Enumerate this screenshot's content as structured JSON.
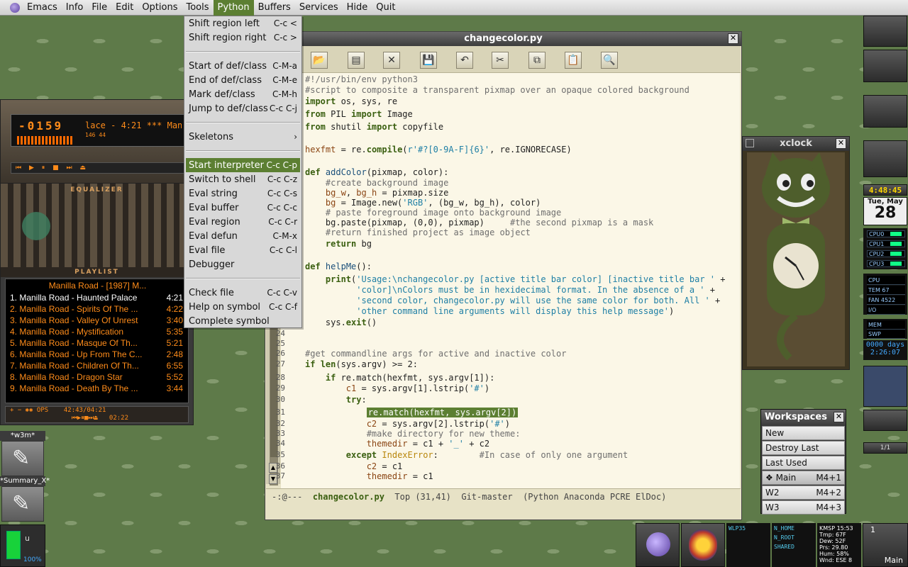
{
  "menubar": {
    "items": [
      "Emacs",
      "Info",
      "File",
      "Edit",
      "Options",
      "Tools",
      "Python",
      "Buffers",
      "Services",
      "Hide",
      "Quit"
    ]
  },
  "python_menu": {
    "rows": [
      {
        "label": "Shift region left",
        "key": "C-c <"
      },
      {
        "label": "Shift region right",
        "key": "C-c >"
      },
      {
        "sep": true
      },
      {
        "label": "Start of def/class",
        "key": "C-M-a"
      },
      {
        "label": "End of def/class",
        "key": "C-M-e"
      },
      {
        "label": "Mark def/class",
        "key": "C-M-h"
      },
      {
        "label": "Jump to def/class",
        "key": "C-c C-j"
      },
      {
        "sep": true
      },
      {
        "label": "Skeletons",
        "key": "›"
      },
      {
        "sep": true
      },
      {
        "label": "Start interpreter",
        "key": "C-c C-p",
        "highlight": true
      },
      {
        "label": "Switch to shell",
        "key": "C-c C-z"
      },
      {
        "label": "Eval string",
        "key": "C-c C-s"
      },
      {
        "label": "Eval buffer",
        "key": "C-c C-c"
      },
      {
        "label": "Eval region",
        "key": "C-c C-r"
      },
      {
        "label": "Eval defun",
        "key": "C-M-x"
      },
      {
        "label": "Eval file",
        "key": "C-c C-l"
      },
      {
        "label": "Debugger",
        "key": ""
      },
      {
        "sep": true
      },
      {
        "label": "Check file",
        "key": "C-c C-v"
      },
      {
        "label": "Help on symbol",
        "key": "C-c C-f"
      },
      {
        "label": "Complete symbol",
        "key": ""
      }
    ]
  },
  "emacs": {
    "title": "changecolor.py",
    "modeline": {
      "flags": "-:@---",
      "buffer": "changecolor.py",
      "position": "Top (31,41)",
      "vc": "Git-master",
      "modes": "(Python Anaconda PCRE ElDoc)"
    },
    "code": [
      {
        "n": "",
        "html": "<span class='cm'>#!/usr/bin/env python3</span>"
      },
      {
        "n": "",
        "html": "<span class='cm'>#script to composite a transparent pixmap over an opaque colored background</span>"
      },
      {
        "n": "",
        "html": "<span class='kw'>import</span> os, sys, re"
      },
      {
        "n": "",
        "html": "<span class='kw'>from</span> PIL <span class='kw'>import</span> Image"
      },
      {
        "n": "",
        "html": "<span class='kw'>from</span> shutil <span class='kw'>import</span> copyfile"
      },
      {
        "n": "",
        "html": ""
      },
      {
        "n": "",
        "html": "<span class='var'>hexfmt</span> = re.<span class='kw'>compile</span>(<span class='st'>r'#?[0-9A-F]{6}'</span>, re.IGNORECASE)"
      },
      {
        "n": "",
        "html": ""
      },
      {
        "n": "",
        "html": "<span class='kw'>def</span> <span class='fn'>addColor</span>(pixmap, color):"
      },
      {
        "n": "",
        "html": "    <span class='cm'>#create background image</span>"
      },
      {
        "n": "",
        "html": "    <span class='var'>bg_w</span>, <span class='var'>bg_h</span> = pixmap.size"
      },
      {
        "n": "",
        "html": "    <span class='var'>bg</span> = Image.new(<span class='st'>'RGB'</span>, (bg_w, bg_h), color)"
      },
      {
        "n": "",
        "html": "    <span class='cm'># paste foreground image onto background image</span>"
      },
      {
        "n": "",
        "html": "    bg.paste(pixmap, (0,0), pixmap)     <span class='cm'>#the second pixmap is a mask</span>"
      },
      {
        "n": "",
        "html": "    <span class='cm'>#return finished project as image object</span>"
      },
      {
        "n": "",
        "html": "    <span class='kw'>return</span> bg"
      },
      {
        "n": "",
        "html": ""
      },
      {
        "n": "",
        "html": "<span class='kw'>def</span> <span class='fn'>helpMe</span>():"
      },
      {
        "n": "",
        "html": "    <span class='kw'>print</span>(<span class='st'>'Usage:\\nchangecolor.py [active title bar color] [inactive title bar '</span> +"
      },
      {
        "n": "",
        "html": "          <span class='st'>'color]\\nColors must be in hexidecimal format. In the absence of a '</span> +"
      },
      {
        "n": "",
        "html": "          <span class='st'>'second color, changecolor.py will use the same color for both. All '</span> +"
      },
      {
        "n": "",
        "html": "          <span class='st'>'other command line arguments will display this help message'</span>)"
      },
      {
        "n": "",
        "html": "    sys.<span class='kw'>exit</span>()"
      },
      {
        "n": "24",
        "html": ""
      },
      {
        "n": "25",
        "html": ""
      },
      {
        "n": "26",
        "html": "<span class='cm'>#get commandline args for active and inactive color</span>"
      },
      {
        "n": "27",
        "html": "<span class='kw'>if</span> <span class='kw'>len</span>(sys.argv) &gt;= 2:"
      },
      {
        "n": "28",
        "html": "    <span class='kw'>if</span> re.match(hexfmt, sys.argv[1]):"
      },
      {
        "n": "29",
        "html": "        <span class='var'>c1</span> = sys.argv[1].lstrip(<span class='st'>'#'</span>)"
      },
      {
        "n": "30",
        "html": "        <span class='kw'>try</span>:"
      },
      {
        "n": "31",
        "html": "            <span class='hlline'>re.match(hexfmt, sys.argv[2])</span>"
      },
      {
        "n": "32",
        "html": "            <span class='var'>c2</span> = sys.argv[2].lstrip(<span class='st'>'#'</span>)"
      },
      {
        "n": "33",
        "html": "            <span class='cm'>#make directory for new theme:</span>"
      },
      {
        "n": "34",
        "html": "            <span class='var'>themedir</span> = c1 + <span class='st'>'_'</span> + c2"
      },
      {
        "n": "35",
        "html": "        <span class='kw'>except</span> <span class='cls'>IndexError</span>:        <span class='cm'>#In case of only one argument</span>"
      },
      {
        "n": "36",
        "html": "            <span class='var'>c2</span> = c1"
      },
      {
        "n": "37",
        "html": "            <span class='var'>themedir</span> = c1"
      }
    ]
  },
  "player": {
    "time": "-0159",
    "scroll": "lace - 4:21  *** Manilla Ro",
    "kbps": "146    44",
    "eq_label": "EQUALIZER",
    "playlist_label": "PLAYLIST",
    "playlist_title": "Manilla Road - [1987] M...",
    "tracks": [
      {
        "title": "1. Manilla Road - Haunted Palace",
        "time": "4:21",
        "current": true
      },
      {
        "title": "2. Manilla Road - Spirits Of The ...",
        "time": "4:22"
      },
      {
        "title": "3. Manilla Road - Valley Of Unrest",
        "time": "3:40"
      },
      {
        "title": "4. Manilla Road - Mystification",
        "time": "5:35"
      },
      {
        "title": "5. Manilla Road - Masque Of Th...",
        "time": "5:21"
      },
      {
        "title": "6. Manilla Road - Up From The C...",
        "time": "2:48"
      },
      {
        "title": "7. Manilla Road - Children Of Th...",
        "time": "6:55"
      },
      {
        "title": "8. Manilla Road - Dragon Star",
        "time": "5:52"
      },
      {
        "title": "9. Manilla Road - Death By The ...",
        "time": "3:44"
      }
    ],
    "footer_time": "42:43/04:21",
    "footer_pos": "02:22"
  },
  "left_icons": [
    {
      "label": "*w3m*"
    },
    {
      "label": "*Summary_X*"
    }
  ],
  "bottomleft": {
    "u": "u",
    "pct": "100%"
  },
  "xclock": {
    "title": "xclock"
  },
  "dock": {
    "clock": "4:48:45",
    "date_day": "Tue, May",
    "date_num": "28",
    "cpus": [
      "CPU0",
      "CPU1",
      "CPU2",
      "CPU3"
    ],
    "sys": [
      "CPU",
      "TEM  67",
      "FAN 4522",
      "I/O"
    ],
    "mem": [
      "MEM",
      "SWP"
    ],
    "uptime1": "0000 days",
    "uptime2": "2:26:07",
    "pager": "1/1"
  },
  "workspaces": {
    "title": "Workspaces",
    "rows": [
      {
        "label": "New",
        "key": ""
      },
      {
        "label": "Destroy Last",
        "key": ""
      },
      {
        "label": "Last Used",
        "key": ""
      },
      {
        "label": "❖ Main",
        "key": "M4+1",
        "current": true
      },
      {
        "label": "W2",
        "key": "M4+2"
      },
      {
        "label": "W3",
        "key": "M4+3"
      }
    ]
  },
  "bottom": {
    "wlan": "WLP35",
    "mon": [
      "N_HOME",
      "N_ROOT",
      "SHARED"
    ],
    "weather": [
      "KMSP  15:53",
      "Tmp: 67F",
      "Dew: 52F",
      "Prs: 29.80",
      "Hum: 58%",
      "Wnd: ESE 8"
    ],
    "pager_num": "1",
    "pager_name": "Main"
  }
}
